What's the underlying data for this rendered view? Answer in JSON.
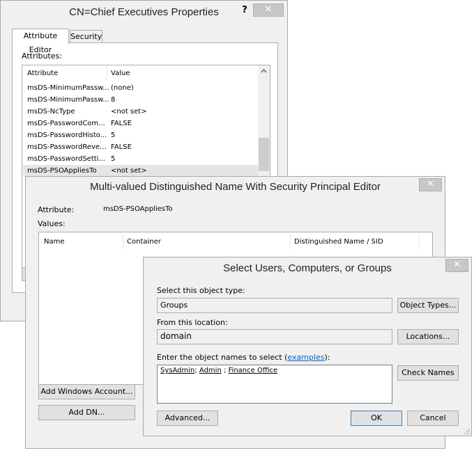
{
  "properties_window": {
    "title": "CN=Chief Executives Properties",
    "help_glyph": "?",
    "close_glyph": "✕",
    "tabs": [
      "Attribute Editor",
      "Security"
    ],
    "attributes_label": "Attributes:",
    "columns": [
      "Attribute",
      "Value"
    ],
    "rows": [
      {
        "attribute": "msDS-MinimumPassw...",
        "value": "(none)"
      },
      {
        "attribute": "msDS-MinimumPassw...",
        "value": "8"
      },
      {
        "attribute": "msDS-NcType",
        "value": "<not set>"
      },
      {
        "attribute": "msDS-PasswordCom...",
        "value": "FALSE"
      },
      {
        "attribute": "msDS-PasswordHisto...",
        "value": "5"
      },
      {
        "attribute": "msDS-PasswordReve...",
        "value": "FALSE"
      },
      {
        "attribute": "msDS-PasswordSetti...",
        "value": "5"
      },
      {
        "attribute": "msDS-PSOAppliesTo",
        "value": "<not set>"
      }
    ],
    "selected_row": 7,
    "scroll_up_glyph": "^"
  },
  "mv_editor": {
    "title": "Multi-valued Distinguished Name With Security Principal Editor",
    "close_glyph": "✕",
    "attribute_label": "Attribute:",
    "attribute_value": "msDS-PSOAppliesTo",
    "values_label": "Values:",
    "columns": [
      "Name",
      "Container",
      "Distinguished Name / SID"
    ],
    "add_windows_account": "Add Windows Account...",
    "add_dn": "Add DN..."
  },
  "select_dialog": {
    "title": "Select Users, Computers, or Groups",
    "close_glyph": "✕",
    "object_type_label": "Select this object type:",
    "object_type_value": "Groups",
    "object_types_button": "Object Types...",
    "location_label": "From this location:",
    "location_value": "domain",
    "locations_button": "Locations...",
    "enter_names_prefix": "Enter the object names to select (",
    "enter_names_link": "examples",
    "enter_names_suffix": "):",
    "names": [
      {
        "text": "SysAdmin",
        "sep": "; "
      },
      {
        "text": "Admin",
        "sep": " ; "
      },
      {
        "text": "Finance Office",
        "sep": ""
      }
    ],
    "check_names_button": "Check Names",
    "advanced_button": "Advanced...",
    "ok_button": "OK",
    "cancel_button": "Cancel"
  },
  "colors": {
    "window_bg": "#f0f0f0",
    "close_button": "#c7c7c7",
    "selected_row": "#e5e5e5",
    "link": "#0066cc"
  }
}
